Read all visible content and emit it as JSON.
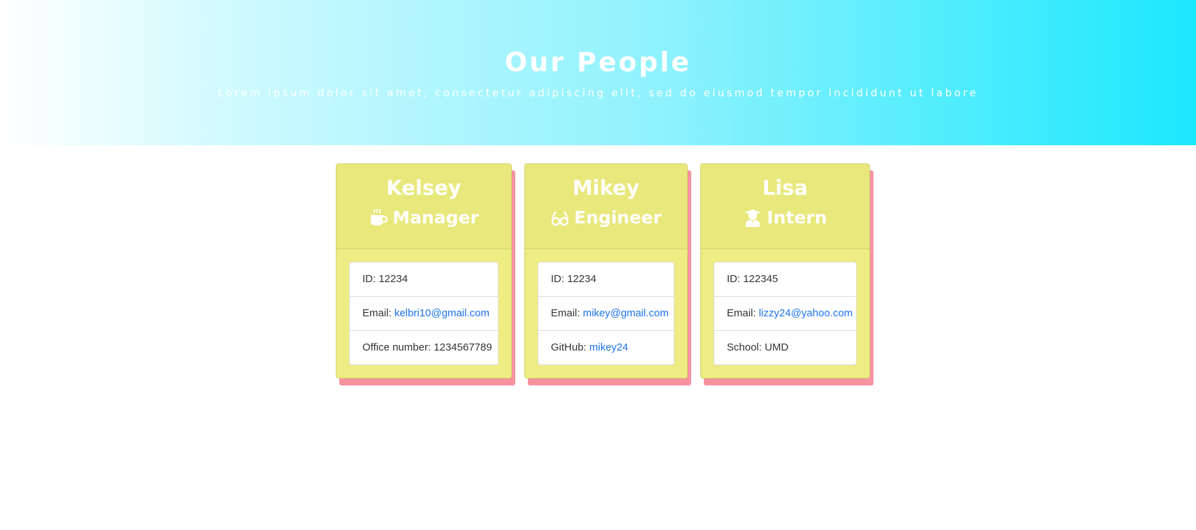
{
  "header": {
    "title": "Our People",
    "subtitle": "Lorem ipsum dolor sit amet, consectetur adipiscing elit, sed do eiusmod tempor incididunt ut labore"
  },
  "colors": {
    "card_bg": "#eded84",
    "card_shadow": "#f7939f",
    "link": "#1a73e8"
  },
  "cards": [
    {
      "name": "Kelsey",
      "role": "Manager",
      "icon": "coffee-icon",
      "id_label": "ID: ",
      "id": "12234",
      "email_label": "Email: ",
      "email": "kelbri10@gmail.com",
      "extra_label": "Office number: ",
      "extra": "1234567789"
    },
    {
      "name": "Mikey",
      "role": "Engineer",
      "icon": "glasses-icon",
      "id_label": "ID: ",
      "id": "12234",
      "email_label": "Email: ",
      "email": "mikey@gmail.com",
      "extra_label": "GitHub: ",
      "extra": "mikey24"
    },
    {
      "name": "Lisa",
      "role": "Intern",
      "icon": "graduate-icon",
      "id_label": "ID: ",
      "id": "122345",
      "email_label": "Email: ",
      "email": "lizzy24@yahoo.com",
      "extra_label": "School: ",
      "extra": "UMD"
    }
  ]
}
